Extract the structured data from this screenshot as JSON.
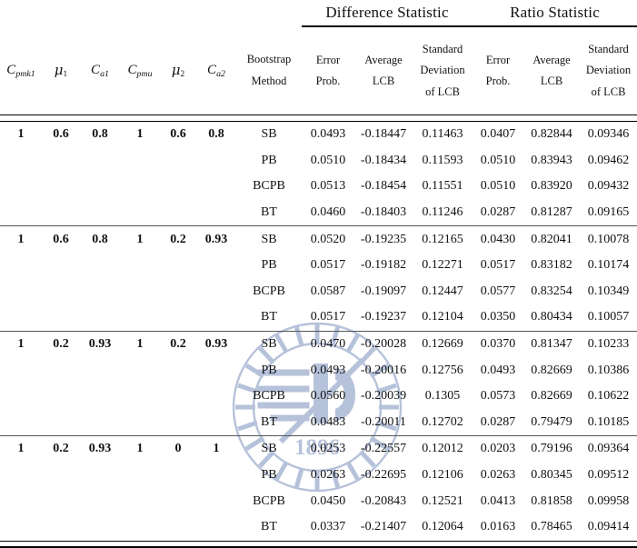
{
  "table": {
    "group_headers": [
      {
        "label": "Difference Statistic"
      },
      {
        "label": "Ratio Statistic"
      }
    ],
    "param_columns": [
      {
        "base": "C",
        "sub": "pmk1"
      },
      {
        "base": "μ",
        "sub": "1"
      },
      {
        "base": "C",
        "sub": "a1"
      },
      {
        "base": "C",
        "sub": "pmu"
      },
      {
        "base": "μ",
        "sub": "2"
      },
      {
        "base": "C",
        "sub": "a2"
      }
    ],
    "method_header": {
      "line1": "Bootstrap",
      "line2": "Method"
    },
    "stat_headers": [
      {
        "line1": "Error",
        "line2": "Prob.",
        "line3": ""
      },
      {
        "line1": "Average",
        "line2": "LCB",
        "line3": ""
      },
      {
        "line1": "Standard",
        "line2": "Deviation",
        "line3": "of LCB"
      },
      {
        "line1": "Error",
        "line2": "Prob.",
        "line3": ""
      },
      {
        "line1": "Average",
        "line2": "LCB",
        "line3": ""
      },
      {
        "line1": "Standard",
        "line2": "Deviation",
        "line3": "of LCB"
      }
    ],
    "blocks": [
      {
        "params": [
          "1",
          "0.6",
          "0.8",
          "1",
          "0.6",
          "0.8"
        ],
        "rows": [
          {
            "method": "SB",
            "values": [
              "0.0493",
              "-0.18447",
              "0.11463",
              "0.0407",
              "0.82844",
              "0.09346"
            ]
          },
          {
            "method": "PB",
            "values": [
              "0.0510",
              "-0.18434",
              "0.11593",
              "0.0510",
              "0.83943",
              "0.09462"
            ]
          },
          {
            "method": "BCPB",
            "values": [
              "0.0513",
              "-0.18454",
              "0.11551",
              "0.0510",
              "0.83920",
              "0.09432"
            ]
          },
          {
            "method": "BT",
            "values": [
              "0.0460",
              "-0.18403",
              "0.11246",
              "0.0287",
              "0.81287",
              "0.09165"
            ]
          }
        ]
      },
      {
        "params": [
          "1",
          "0.6",
          "0.8",
          "1",
          "0.2",
          "0.93"
        ],
        "rows": [
          {
            "method": "SB",
            "values": [
              "0.0520",
              "-0.19235",
              "0.12165",
              "0.0430",
              "0.82041",
              "0.10078"
            ]
          },
          {
            "method": "PB",
            "values": [
              "0.0517",
              "-0.19182",
              "0.12271",
              "0.0517",
              "0.83182",
              "0.10174"
            ]
          },
          {
            "method": "BCPB",
            "values": [
              "0.0587",
              "-0.19097",
              "0.12447",
              "0.0577",
              "0.83254",
              "0.10349"
            ]
          },
          {
            "method": "BT",
            "values": [
              "0.0517",
              "-0.19237",
              "0.12104",
              "0.0350",
              "0.80434",
              "0.10057"
            ]
          }
        ]
      },
      {
        "params": [
          "1",
          "0.2",
          "0.93",
          "1",
          "0.2",
          "0.93"
        ],
        "rows": [
          {
            "method": "SB",
            "values": [
              "0.0470",
              "-0.20028",
              "0.12669",
              "0.0370",
              "0.81347",
              "0.10233"
            ]
          },
          {
            "method": "PB",
            "values": [
              "0.0493",
              "-0.20016",
              "0.12756",
              "0.0493",
              "0.82669",
              "0.10386"
            ]
          },
          {
            "method": "BCPB",
            "values": [
              "0.0560",
              "-0.20039",
              "0.1305",
              "0.0573",
              "0.82669",
              "0.10622"
            ]
          },
          {
            "method": "BT",
            "values": [
              "0.0483",
              "-0.20011",
              "0.12702",
              "0.0287",
              "0.79479",
              "0.10185"
            ]
          }
        ]
      },
      {
        "params": [
          "1",
          "0.2",
          "0.93",
          "1",
          "0",
          "1"
        ],
        "rows": [
          {
            "method": "SB",
            "values": [
              "0.0253",
              "-0.22557",
              "0.12012",
              "0.0203",
              "0.79196",
              "0.09364"
            ]
          },
          {
            "method": "PB",
            "values": [
              "0.0263",
              "-0.22695",
              "0.12106",
              "0.0263",
              "0.80345",
              "0.09512"
            ]
          },
          {
            "method": "BCPB",
            "values": [
              "0.0450",
              "-0.20843",
              "0.12521",
              "0.0413",
              "0.81858",
              "0.09958"
            ]
          },
          {
            "method": "BT",
            "values": [
              "0.0337",
              "-0.21407",
              "0.12064",
              "0.0163",
              "0.78465",
              "0.09414"
            ]
          }
        ]
      }
    ]
  },
  "watermark": {
    "year": "1896",
    "color": "#9aabcc"
  }
}
